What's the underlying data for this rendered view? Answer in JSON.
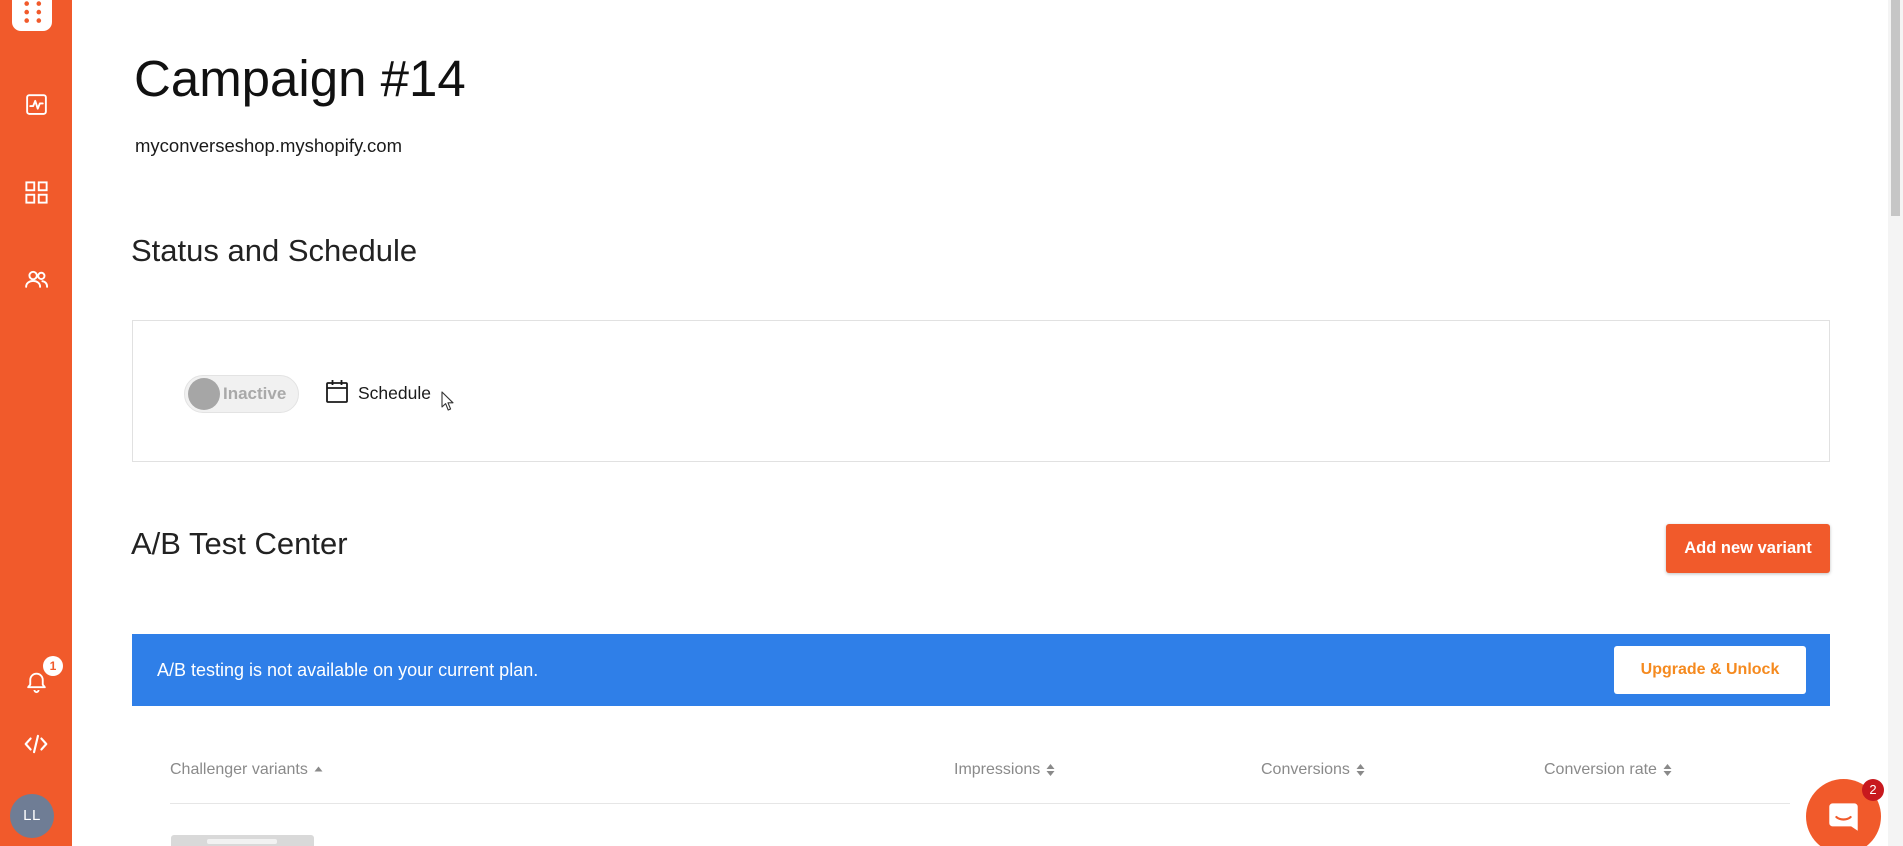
{
  "sidebar": {
    "logo_icon": "apps-grid-icon",
    "nav_icons": [
      "activity-chart-icon",
      "dashboard-grid-icon",
      "users-icon"
    ],
    "notifications": {
      "icon": "bell-icon",
      "badge": "1"
    },
    "developer_icon": "code-icon",
    "avatar_initials": "LL"
  },
  "header": {
    "title": "Campaign #14",
    "store_domain": "myconverseshop.myshopify.com"
  },
  "status_schedule": {
    "heading": "Status and Schedule",
    "status_toggle": {
      "label": "Inactive"
    },
    "schedule": {
      "icon": "calendar-icon",
      "label": "Schedule"
    }
  },
  "ab_test_center": {
    "heading": "A/B Test Center",
    "add_variant_label": "Add new variant",
    "upgrade_banner": {
      "message": "A/B testing is not available on your current plan.",
      "button_label": "Upgrade & Unlock"
    },
    "table": {
      "columns": [
        {
          "label": "Challenger variants",
          "sort_icon": "sort-ascending-icon"
        },
        {
          "label": "Impressions",
          "sort_icon": "sort-icon"
        },
        {
          "label": "Conversions",
          "sort_icon": "sort-icon"
        },
        {
          "label": "Conversion rate",
          "sort_icon": "sort-icon"
        }
      ]
    }
  },
  "chat_widget": {
    "icon": "chat-icon",
    "unread_badge": "2"
  },
  "colors": {
    "brand": "#F15A2B",
    "banner": "#2F7FE8",
    "upgrade_text": "#F58A1F",
    "chat_badge": "#C8191E",
    "avatar": "#6F7D95"
  }
}
